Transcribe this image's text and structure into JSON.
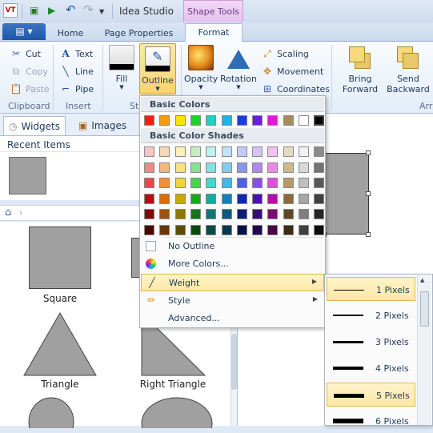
{
  "titlebar": {
    "app_title": "Idea Studio",
    "context_group": "Shape Tools",
    "logo_text": "VT"
  },
  "tabs": {
    "file_icon": "menu-icon",
    "home": "Home",
    "page_properties": "Page Properties",
    "format": "Format"
  },
  "ribbon": {
    "clipboard": {
      "label": "Clipboard",
      "cut": "Cut",
      "copy": "Copy",
      "paste": "Paste"
    },
    "insert": {
      "label": "Insert",
      "text": "Text",
      "line": "Line",
      "pipe": "Pipe"
    },
    "style": {
      "label": "St",
      "fill": "Fill",
      "outline": "Outline"
    },
    "effects": {
      "opacity": "Opacity",
      "rotation": "Rotation",
      "scaling": "Scaling",
      "movement": "Movement",
      "coordinates": "Coordinates"
    },
    "arrange": {
      "label": "Arr",
      "bring_forward": "Bring Forward",
      "send_backward": "Send Backward"
    }
  },
  "left_panel": {
    "tab_widgets": "Widgets",
    "tab_images": "Images",
    "recent_items": "Recent Items",
    "shapes": [
      "Square",
      "Triangle",
      "Right Triangle"
    ]
  },
  "outline_menu": {
    "basic_colors_header": "Basic Colors",
    "basic_colors": [
      "#e8221a",
      "#f39c12",
      "#f7e600",
      "#1fd12a",
      "#1fd1c8",
      "#1eb4e6",
      "#1a3ed8",
      "#6a1ed8",
      "#d81ed0",
      "#a68b5b",
      "#ffffff",
      "#000000"
    ],
    "shades_header": "Basic Color Shades",
    "shade_rows": [
      [
        "#f5c6c6",
        "#f9d6b5",
        "#fbf0b5",
        "#c4efc0",
        "#bff0ee",
        "#bfe4f7",
        "#c2caf5",
        "#d5c3f5",
        "#f3c2f0",
        "#e6d9c2",
        "#f2f2f2",
        "#8c8c8c"
      ],
      [
        "#ec8a8a",
        "#f5b57b",
        "#f7e27a",
        "#87e08a",
        "#82e3df",
        "#82cdef",
        "#8a98ea",
        "#ad8aea",
        "#e88ae4",
        "#cfb88e",
        "#d9d9d9",
        "#737373"
      ],
      [
        "#e04a4a",
        "#f08f3a",
        "#f2d23a",
        "#4cd152",
        "#46d6ce",
        "#46b6e6",
        "#4c62e0",
        "#8650e0",
        "#dc50d6",
        "#b79a66",
        "#bfbfbf",
        "#595959"
      ],
      [
        "#b01010",
        "#d86f0d",
        "#c9a800",
        "#18a820",
        "#14aaa2",
        "#147fb8",
        "#1028b0",
        "#4d10b0",
        "#b010a8",
        "#8a6a3a",
        "#a6a6a6",
        "#404040"
      ],
      [
        "#7a0b0b",
        "#a0520a",
        "#8f7800",
        "#107814",
        "#0e7874",
        "#0e5a82",
        "#0b1c7a",
        "#360b7a",
        "#7a0b74",
        "#5e4828",
        "#808080",
        "#262626"
      ],
      [
        "#4a0606",
        "#6a3606",
        "#5c4e00",
        "#0a4a0c",
        "#084a48",
        "#083850",
        "#06124a",
        "#22064a",
        "#4a0646",
        "#3a2c18",
        "#404040",
        "#0d0d0d"
      ]
    ],
    "no_outline": "No Outline",
    "more_colors": "More Colors...",
    "weight": "Weight",
    "style": "Style",
    "advanced": "Advanced..."
  },
  "weight_menu": {
    "items": [
      {
        "label": "1 Pixels",
        "thickness_px": 1,
        "selected": true
      },
      {
        "label": "2 Pixels",
        "thickness_px": 2,
        "selected": false
      },
      {
        "label": "3 Pixels",
        "thickness_px": 3,
        "selected": false
      },
      {
        "label": "4 Pixels",
        "thickness_px": 4,
        "selected": false
      },
      {
        "label": "5 Pixels",
        "thickness_px": 5,
        "selected": true
      },
      {
        "label": "6 Pixels",
        "thickness_px": 6,
        "selected": false
      }
    ]
  }
}
